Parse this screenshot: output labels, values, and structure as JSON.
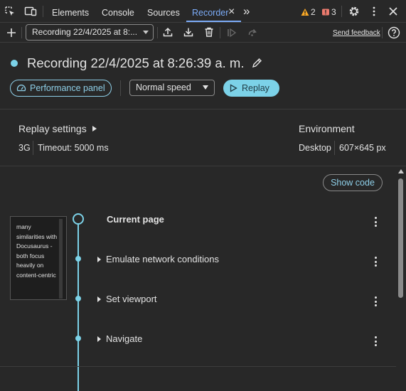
{
  "tabs": {
    "elements": "Elements",
    "console": "Console",
    "sources": "Sources",
    "recorder": "Recorder",
    "close": "×",
    "more": "»"
  },
  "badges": {
    "warnings": "2",
    "issues": "3"
  },
  "toolbar": {
    "recording_select": "Recording 22/4/2025 at 8:...",
    "send_feedback": "Send feedback"
  },
  "recording": {
    "title": "Recording 22/4/2025 at 8:26:39 a. m.",
    "performance_panel": "Performance panel",
    "speed": "Normal speed",
    "replay": "Replay"
  },
  "replay_settings": {
    "title": "Replay settings",
    "network": "3G",
    "timeout": "Timeout: 5000 ms"
  },
  "environment": {
    "title": "Environment",
    "device": "Desktop",
    "viewport": "607×645 px"
  },
  "steps": {
    "show_code": "Show code",
    "thumbnail_text": "many similarities with Docusaurus - both focus heavily on content-centric",
    "current_page": "Current page",
    "items": [
      "Emulate network conditions",
      "Set viewport",
      "Navigate"
    ]
  },
  "colors": {
    "accent": "#7cd2e8",
    "active_tab": "#7cacf8",
    "warning": "#f9a825",
    "issue": "#ec7b6e"
  }
}
